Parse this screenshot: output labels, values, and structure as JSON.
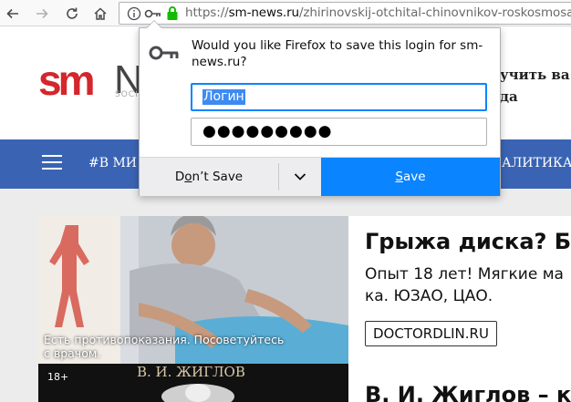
{
  "browser": {
    "back_icon": "arrow-left-icon",
    "forward_icon": "arrow-right-icon",
    "reload_icon": "reload-icon",
    "home_icon": "home-icon",
    "url_prefix": "https://",
    "url_host": "sm-news.ru",
    "url_path": "/zhirinovskij-otchital-chinovnikov-roskosmosa"
  },
  "site": {
    "logo_sm": "sm",
    "logo_n": "N",
    "logo_sub": "SOCI",
    "header_promo_line1": "учить ва",
    "header_promo_line2": "да",
    "nav_left": "#В МИ",
    "nav_right": "АЛИТИКА"
  },
  "cards": [
    {
      "title": "Грыжа диска? Б",
      "text_line1": "Опыт 18 лет! Мягкие ма",
      "text_line2": "ка. ЮЗАО, ЦАО.",
      "button": "DOCTORDLIN.RU",
      "caption_line1": "Есть противопоказания. Посоветуйтесь",
      "caption_line2": "с врачом."
    },
    {
      "title": "В. И. Жиглов – к",
      "img_text": "В. И. ЖИГЛОВ",
      "age_badge": "18+"
    }
  ],
  "doorhanger": {
    "message": "Would you like Firefox to save this login for sm-news.ru?",
    "username": "Логин",
    "password_mask": "●●●●●●●●●",
    "dont_save_pre": "D",
    "dont_save_acc": "o",
    "dont_save_post": "n’t Save",
    "save_acc": "S",
    "save_post": "ave"
  }
}
